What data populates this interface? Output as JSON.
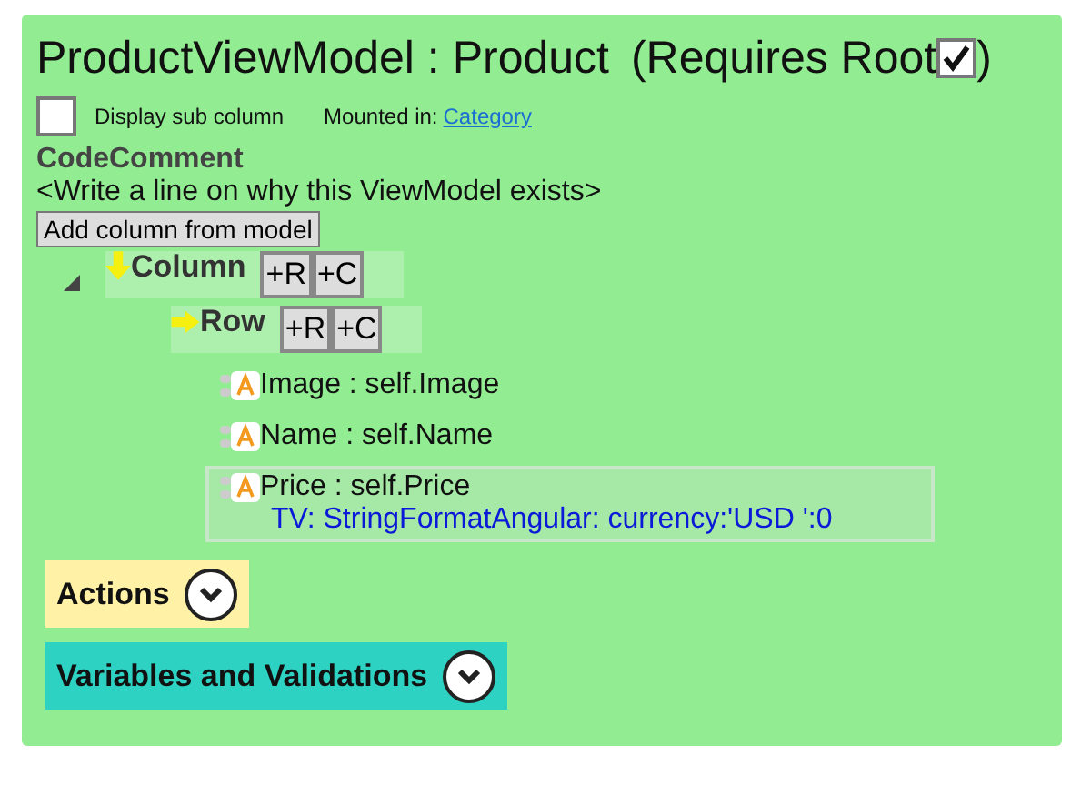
{
  "title": {
    "name": "ProductViewModel : Product",
    "suffix": "(Requires Root",
    "root_checked": true,
    "close": ")"
  },
  "display_sub_column": {
    "label": "Display sub column",
    "checked": false
  },
  "mounted": {
    "label": "Mounted in:",
    "link": "Category"
  },
  "code_comment": {
    "heading": "CodeComment",
    "text": "<Write a line on why this ViewModel exists>"
  },
  "add_button": "Add column from model",
  "tree": [
    {
      "label": "Column",
      "expanded": true,
      "buttons": [
        "+R",
        "+C"
      ],
      "children": [
        {
          "label": "Row",
          "buttons": [
            "+R",
            "+C"
          ],
          "children": [
            {
              "label": "Image : self.Image",
              "selected": false
            },
            {
              "label": "Name : self.Name",
              "selected": false
            },
            {
              "label": "Price : self.Price",
              "detail": "TV: StringFormatAngular: currency:'USD  ':0",
              "selected": true
            }
          ]
        }
      ]
    }
  ],
  "sections": [
    {
      "label": "Actions",
      "color": "#fff1a6"
    },
    {
      "label": "Variables and Validations",
      "color": "#2ed2c2"
    }
  ]
}
